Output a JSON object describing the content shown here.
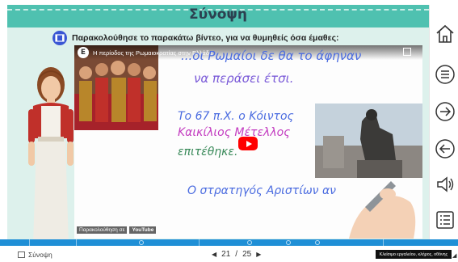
{
  "header": {
    "title": "Σύνοψη"
  },
  "instruction": {
    "text": "Παρακολούθησε το παρακάτω βίντεο, για να θυμηθείς όσα έμαθες:"
  },
  "video": {
    "title": "Η περίοδος της Ρωμαιοκρατίας στην Ελλάδα",
    "handwritten": [
      "...οι Ρωμαίοι δε θα το άφηναν",
      "να περάσει έτσι.",
      "Το 67 π.Χ. ο Κόιντος",
      "Καικίλιος Μέτελλος",
      "επιτέθηκε.",
      "Ο στρατηγός Αριστίων αν"
    ],
    "watch_on": "Παρακολούθηση σε",
    "youtube": "YouTube"
  },
  "sidebar": {
    "icons": [
      "home-icon",
      "menu-icon",
      "next-icon",
      "prev-icon",
      "sound-icon",
      "list-icon"
    ]
  },
  "footer": {
    "section": "Σύνοψη",
    "page_current": "21",
    "page_total": "25",
    "page_sep": "/",
    "right_label": "Κλείσιμο εργαλείου, κλήρος, οθόνης"
  },
  "colors": {
    "header": "#4fc1b0",
    "slide_bg": "#ddf1ec",
    "strip": "#1f8fd6",
    "film_badge": "#3a56d4"
  }
}
